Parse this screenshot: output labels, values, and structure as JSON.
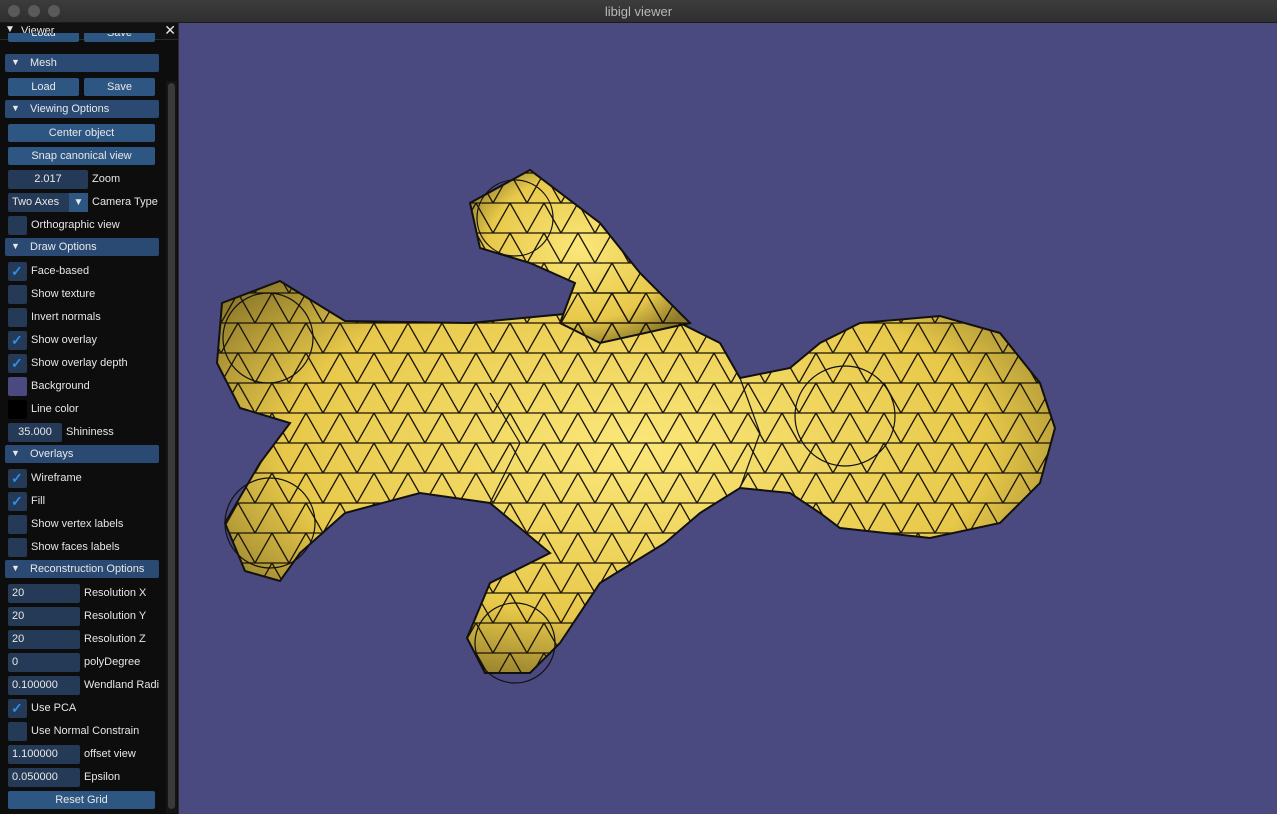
{
  "window": {
    "title": "libigl viewer"
  },
  "panel": {
    "title": "Viewer",
    "top_partial": {
      "load": "Load",
      "save": "Save"
    },
    "mesh": {
      "header": "Mesh",
      "load": "Load",
      "save": "Save"
    },
    "viewing": {
      "header": "Viewing Options",
      "center_object": "Center object",
      "snap_view": "Snap canonical view",
      "zoom_value": "2.017",
      "zoom_label": "Zoom",
      "camera_value": "Two Axes",
      "camera_label": "Camera Type",
      "ortho_label": "Orthographic view",
      "ortho_checked": false
    },
    "draw": {
      "header": "Draw Options",
      "face_based": "Face-based",
      "show_texture": "Show texture",
      "invert_normals": "Invert normals",
      "show_overlay": "Show overlay",
      "show_overlay_depth": "Show overlay depth",
      "background": "Background",
      "background_color": "#4b4a80",
      "line_color": "Line color",
      "line_color_value": "#000000",
      "shininess_value": "35.000",
      "shininess_label": "Shininess"
    },
    "overlays": {
      "header": "Overlays",
      "wireframe": "Wireframe",
      "fill": "Fill",
      "vertex_labels": "Show vertex labels",
      "face_labels": "Show faces labels"
    },
    "recon": {
      "header": "Reconstruction Options",
      "res_x_value": "20",
      "res_x_label": "Resolution X",
      "res_y_value": "20",
      "res_y_label": "Resolution Y",
      "res_z_value": "20",
      "res_z_label": "Resolution Z",
      "poly_value": "0",
      "poly_label": "polyDegree",
      "wendland_value": "0.100000",
      "wendland_label": "Wendland Radi",
      "use_pca": "Use PCA",
      "use_normal": "Use Normal Constrain",
      "offset_value": "1.100000",
      "offset_label": "offset view",
      "eps_value": "0.050000",
      "eps_label": "Epsilon",
      "reset_grid": "Reset Grid"
    }
  },
  "colors": {
    "accent_check": "#2d8ef0",
    "header_bg": "#2a4a74",
    "button_bg": "#2e5682",
    "mesh_fill": "#f5dc5a",
    "viewport_bg": "#4b4a80"
  }
}
